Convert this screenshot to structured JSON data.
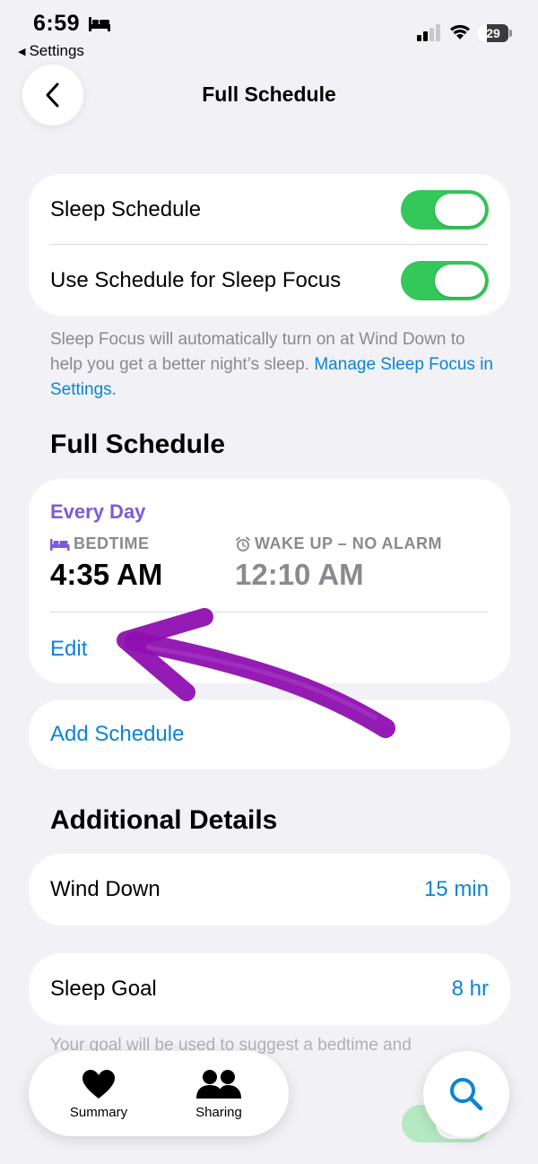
{
  "status_bar": {
    "time": "6:59",
    "back_app": "Settings",
    "battery": "29"
  },
  "nav": {
    "title": "Full Schedule"
  },
  "focus_card": {
    "sleep_schedule_label": "Sleep Schedule",
    "sleep_schedule_on": true,
    "sleep_focus_label": "Use Schedule for Sleep Focus",
    "sleep_focus_on": true
  },
  "focus_note": {
    "text": "Sleep Focus will automatically turn on at Wind Down to help you get a better night’s sleep. ",
    "link": "Manage Sleep Focus in Settings."
  },
  "full_schedule": {
    "heading": "Full Schedule",
    "days": "Every Day",
    "bedtime_label": "BEDTIME",
    "bedtime": "4:35 AM",
    "wake_label": "WAKE UP – NO ALARM",
    "wake": "12:10 AM",
    "edit": "Edit",
    "add_schedule": "Add Schedule"
  },
  "additional": {
    "heading": "Additional Details",
    "wind_down_label": "Wind Down",
    "wind_down_value": "15 min",
    "sleep_goal_label": "Sleep Goal",
    "sleep_goal_value": "8 hr",
    "goal_note": "Your goal will be used to suggest a bedtime and"
  },
  "tab_bar": {
    "summary": "Summary",
    "sharing": "Sharing"
  },
  "colors": {
    "accent": "#0a84d6",
    "toggle_on": "#34c759",
    "schedule_purple": "#7b5bd9",
    "annotation_arrow": "#8e0fb0"
  }
}
